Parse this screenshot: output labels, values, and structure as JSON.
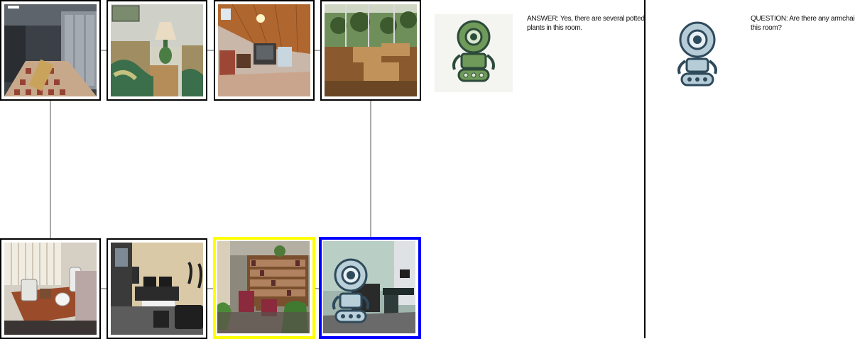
{
  "dialog": {
    "answer_text": "ANSWER: Yes, there are several potted plants in this room.",
    "question_text": "QUESTION: Are there any armchairs in this room?"
  },
  "rooms": [
    {
      "name": "locker-room"
    },
    {
      "name": "bedroom-with-lamp"
    },
    {
      "name": "attic-living-room"
    },
    {
      "name": "study-hall"
    },
    {
      "name": "kitchen-counter"
    },
    {
      "name": "music-studio"
    },
    {
      "name": "library-with-plants"
    },
    {
      "name": "office-with-robot"
    }
  ],
  "colors": {
    "highlight_current": "#ffff00",
    "highlight_agent": "#0000ff",
    "answer_bot": "#6f9a5a",
    "question_bot": "#b6cdd8"
  }
}
